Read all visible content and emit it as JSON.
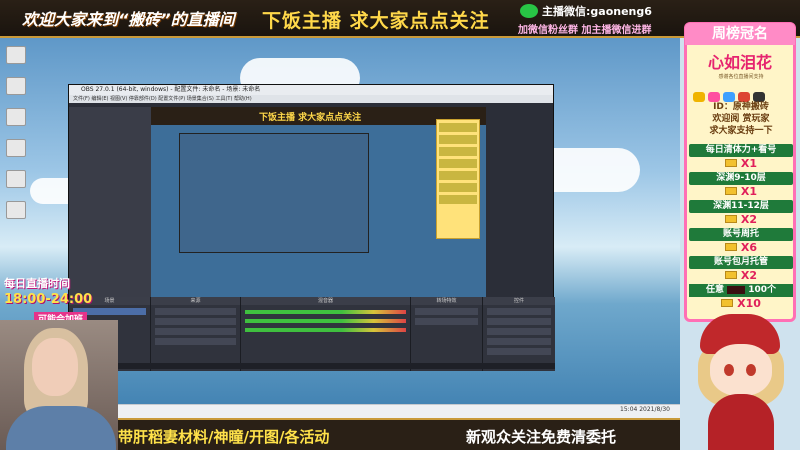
{
  "header": {
    "welcome": "欢迎大家来到“搬砖”的直播间",
    "slogan": "下饭主播 求大家点点关注",
    "wechat_label": "主播微信:gaoneng6",
    "wechat_sub": "加微信粉丝群 加主播微信进群"
  },
  "schedule": {
    "title": "每日直播时间",
    "time": "18:00-24:00",
    "note": "可能会加班"
  },
  "bottom_banner": {
    "left": "带肝稻妻材料/神瞳/开图/各活动",
    "right": "新观众关注免费清委托"
  },
  "ranking": {
    "header": "周榜冠名",
    "champion": "心如泪花",
    "sub": "感谢各位直播间支持",
    "contact": [
      "ID：原神搬砖",
      "欢迎阅 赏玩家",
      "求大家支持一下"
    ],
    "tiers": [
      {
        "req": "每日清体力+看号",
        "reward": "X1"
      },
      {
        "req": "深渊9-10层",
        "reward": "X1"
      },
      {
        "req": "深渊11-12层",
        "reward": "X2"
      },
      {
        "req": "账号周托",
        "reward": "X6"
      },
      {
        "req": "账号包月托管",
        "reward": "X2"
      }
    ],
    "last": {
      "req_prefix": "任意",
      "req_suffix": "100个",
      "reward": "X10"
    }
  },
  "obs": {
    "title": "OBS 27.0.1 (64-bit, windows) - 配置文件: 未命名 - 场景: 未命名",
    "menu": "文件(F) 编辑(E) 视图(V) 停靠部件(D) 配置文件(P) 场景集合(S) 工具(T) 帮助(H)",
    "docks": [
      "场景",
      "来源",
      "混音器",
      "转场特效",
      "控件"
    ],
    "controls": [
      "开始推流",
      "开始录制",
      "启动虚拟摄像机",
      "工作室模式",
      "设置",
      "退出"
    ]
  },
  "taskbar": {
    "tray": "15:04  2021/8/30"
  },
  "colors": {
    "accent": "#ff6fb5",
    "gold": "#ffd84a",
    "green": "#1f7a3a"
  }
}
